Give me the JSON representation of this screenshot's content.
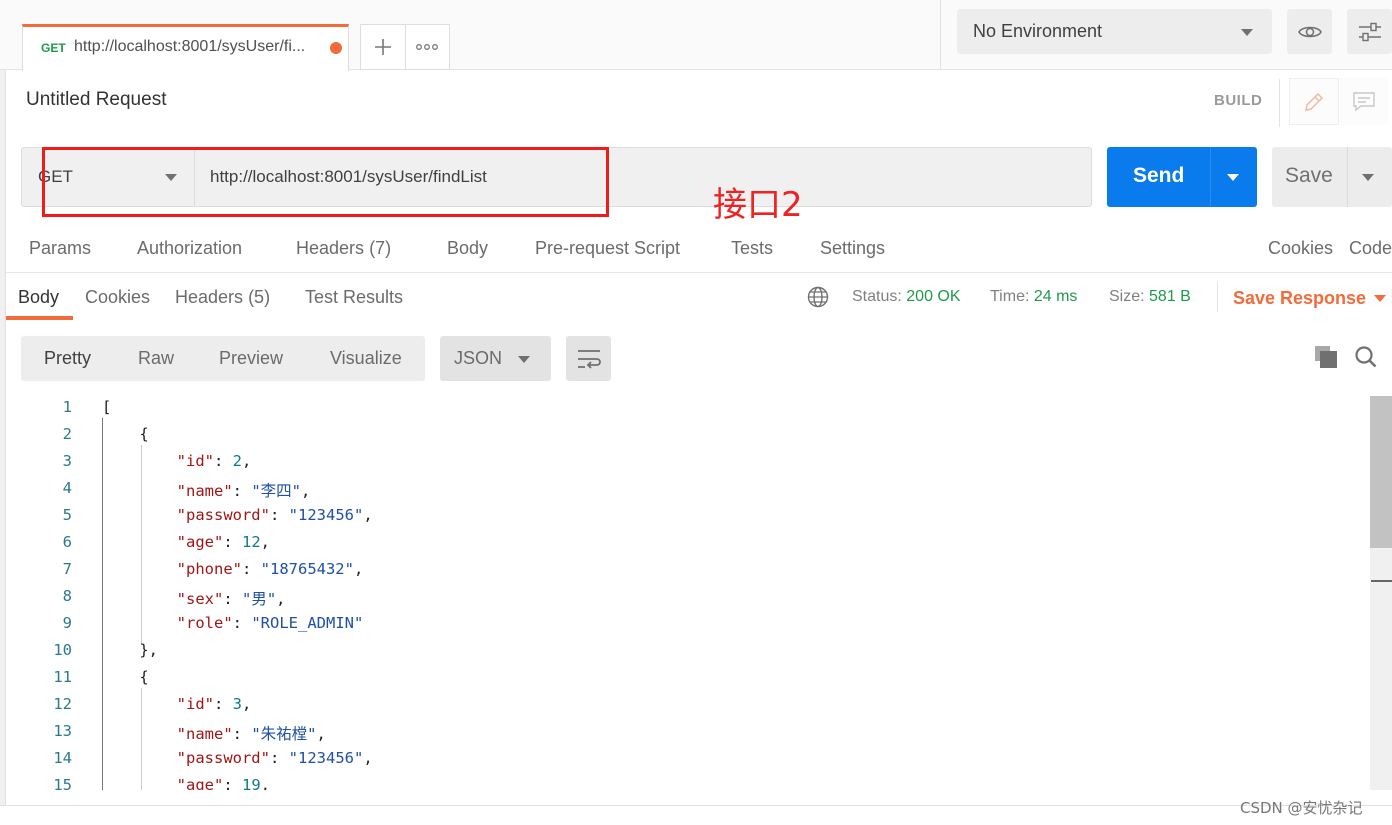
{
  "tabbar": {
    "tab": {
      "method": "GET",
      "url": "http://localhost:8001/sysUser/fi..."
    },
    "new_tab_icon": "plus-icon",
    "more_icon": "more-icon"
  },
  "environment": {
    "selected": "No Environment"
  },
  "request": {
    "title": "Untitled Request",
    "mode": "BUILD",
    "method": "GET",
    "url": "http://localhost:8001/sysUser/findList",
    "send_label": "Send",
    "save_label": "Save",
    "annotation": "接口2"
  },
  "request_tabs": {
    "params": "Params",
    "authorization": "Authorization",
    "headers": "Headers",
    "headers_count": "(7)",
    "body": "Body",
    "prerequest": "Pre-request Script",
    "tests": "Tests",
    "settings": "Settings",
    "cookies": "Cookies",
    "code": "Code"
  },
  "response_tabs": {
    "body": "Body",
    "cookies": "Cookies",
    "headers": "Headers",
    "headers_count": "(5)",
    "test_results": "Test Results"
  },
  "response_meta": {
    "status_label": "Status:",
    "status_value": "200 OK",
    "time_label": "Time:",
    "time_value": "24 ms",
    "size_label": "Size:",
    "size_value": "581 B",
    "save_response": "Save Response"
  },
  "format_bar": {
    "pretty": "Pretty",
    "raw": "Raw",
    "preview": "Preview",
    "visualize": "Visualize",
    "language": "JSON"
  },
  "code_lines": [
    [
      {
        "t": "p",
        "v": "["
      }
    ],
    [
      {
        "t": "p",
        "v": "    {"
      }
    ],
    [
      {
        "t": "p",
        "v": "        "
      },
      {
        "t": "k",
        "v": "\"id\""
      },
      {
        "t": "p",
        "v": ": "
      },
      {
        "t": "n",
        "v": "2"
      },
      {
        "t": "p",
        "v": ","
      }
    ],
    [
      {
        "t": "p",
        "v": "        "
      },
      {
        "t": "k",
        "v": "\"name\""
      },
      {
        "t": "p",
        "v": ": "
      },
      {
        "t": "s",
        "v": "\"李四\""
      },
      {
        "t": "p",
        "v": ","
      }
    ],
    [
      {
        "t": "p",
        "v": "        "
      },
      {
        "t": "k",
        "v": "\"password\""
      },
      {
        "t": "p",
        "v": ": "
      },
      {
        "t": "s",
        "v": "\"123456\""
      },
      {
        "t": "p",
        "v": ","
      }
    ],
    [
      {
        "t": "p",
        "v": "        "
      },
      {
        "t": "k",
        "v": "\"age\""
      },
      {
        "t": "p",
        "v": ": "
      },
      {
        "t": "n",
        "v": "12"
      },
      {
        "t": "p",
        "v": ","
      }
    ],
    [
      {
        "t": "p",
        "v": "        "
      },
      {
        "t": "k",
        "v": "\"phone\""
      },
      {
        "t": "p",
        "v": ": "
      },
      {
        "t": "s",
        "v": "\"18765432\""
      },
      {
        "t": "p",
        "v": ","
      }
    ],
    [
      {
        "t": "p",
        "v": "        "
      },
      {
        "t": "k",
        "v": "\"sex\""
      },
      {
        "t": "p",
        "v": ": "
      },
      {
        "t": "s",
        "v": "\"男\""
      },
      {
        "t": "p",
        "v": ","
      }
    ],
    [
      {
        "t": "p",
        "v": "        "
      },
      {
        "t": "k",
        "v": "\"role\""
      },
      {
        "t": "p",
        "v": ": "
      },
      {
        "t": "s",
        "v": "\"ROLE_ADMIN\""
      }
    ],
    [
      {
        "t": "p",
        "v": "    },"
      }
    ],
    [
      {
        "t": "p",
        "v": "    {"
      }
    ],
    [
      {
        "t": "p",
        "v": "        "
      },
      {
        "t": "k",
        "v": "\"id\""
      },
      {
        "t": "p",
        "v": ": "
      },
      {
        "t": "n",
        "v": "3"
      },
      {
        "t": "p",
        "v": ","
      }
    ],
    [
      {
        "t": "p",
        "v": "        "
      },
      {
        "t": "k",
        "v": "\"name\""
      },
      {
        "t": "p",
        "v": ": "
      },
      {
        "t": "s",
        "v": "\"朱祐樘\""
      },
      {
        "t": "p",
        "v": ","
      }
    ],
    [
      {
        "t": "p",
        "v": "        "
      },
      {
        "t": "k",
        "v": "\"password\""
      },
      {
        "t": "p",
        "v": ": "
      },
      {
        "t": "s",
        "v": "\"123456\""
      },
      {
        "t": "p",
        "v": ","
      }
    ],
    [
      {
        "t": "p",
        "v": "        "
      },
      {
        "t": "k",
        "v": "\"age\""
      },
      {
        "t": "p",
        "v": ": "
      },
      {
        "t": "n",
        "v": "19"
      },
      {
        "t": "p",
        "v": ","
      }
    ]
  ],
  "watermark": "CSDN @安忧杂记",
  "colors": {
    "accent": "#f26b3a",
    "send": "#097bed",
    "success": "#1f9a4b",
    "annotation": "#ee1c1c"
  }
}
